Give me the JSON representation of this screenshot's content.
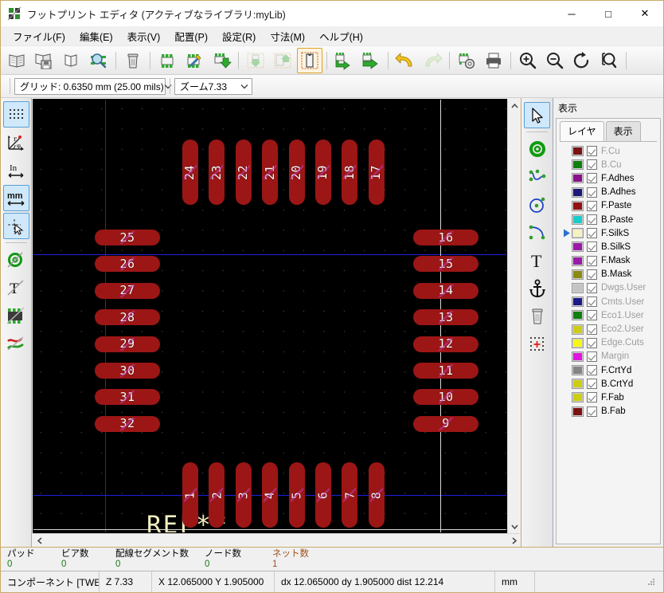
{
  "window": {
    "title": "フットプリント エディタ (アクティブなライブラリ:myLib)",
    "icon": "kicad-footprint-editor-icon",
    "minimize_label": "─",
    "maximize_label": "□",
    "close_label": "✕"
  },
  "menubar": {
    "items": [
      {
        "label": "ファイル(F)",
        "name": "menu-file"
      },
      {
        "label": "編集(E)",
        "name": "menu-edit"
      },
      {
        "label": "表示(V)",
        "name": "menu-view"
      },
      {
        "label": "配置(P)",
        "name": "menu-place"
      },
      {
        "label": "設定(R)",
        "name": "menu-preferences"
      },
      {
        "label": "寸法(M)",
        "name": "menu-dimensions"
      },
      {
        "label": "ヘルプ(H)",
        "name": "menu-help"
      }
    ]
  },
  "toolbar_top": {
    "buttons": [
      {
        "name": "select-active-library-button",
        "icon": "open-book-icon",
        "state": "normal"
      },
      {
        "name": "save-library-button",
        "icon": "book-save-icon",
        "state": "normal"
      },
      {
        "name": "new-footprint-button",
        "icon": "book-new-icon",
        "state": "normal"
      },
      {
        "name": "open-footprint-button",
        "icon": "footprint-search-icon",
        "state": "normal"
      },
      {
        "name": "separator-1",
        "icon": "separator",
        "state": "sep"
      },
      {
        "name": "delete-footprint-button",
        "icon": "trash-icon",
        "state": "normal"
      },
      {
        "name": "separator-2",
        "icon": "separator",
        "state": "sep"
      },
      {
        "name": "import-footprint-button",
        "icon": "footprint-chip-icon",
        "state": "normal"
      },
      {
        "name": "footprint-properties-button",
        "icon": "footprint-edit-icon",
        "state": "normal"
      },
      {
        "name": "export-footprint-button",
        "icon": "footprint-down-icon",
        "state": "normal"
      },
      {
        "name": "separator-3",
        "icon": "separator",
        "state": "sep"
      },
      {
        "name": "import-from-board-button",
        "icon": "board-import-icon",
        "state": "disabled"
      },
      {
        "name": "update-to-board-button",
        "icon": "board-update-icon",
        "state": "disabled"
      },
      {
        "name": "footprint-mode-button",
        "icon": "module-outline-icon",
        "state": "selected"
      },
      {
        "name": "separator-4",
        "icon": "separator",
        "state": "sep"
      },
      {
        "name": "import-module-button",
        "icon": "footprint-arrow-right-icon",
        "state": "normal"
      },
      {
        "name": "export-module-button",
        "icon": "footprint-arrow-out-icon",
        "state": "normal"
      },
      {
        "name": "separator-5",
        "icon": "separator",
        "state": "sep"
      },
      {
        "name": "undo-button",
        "icon": "undo-arrow-icon",
        "state": "normal"
      },
      {
        "name": "redo-button",
        "icon": "redo-arrow-icon",
        "state": "disabled"
      },
      {
        "name": "separator-6",
        "icon": "separator",
        "state": "sep"
      },
      {
        "name": "module-properties-button",
        "icon": "footprint-gear-icon",
        "state": "normal"
      },
      {
        "name": "print-button",
        "icon": "printer-icon",
        "state": "normal"
      },
      {
        "name": "separator-7",
        "icon": "separator",
        "state": "sep"
      },
      {
        "name": "zoom-in-button",
        "icon": "zoom-in-icon",
        "state": "normal"
      },
      {
        "name": "zoom-out-button",
        "icon": "zoom-out-icon",
        "state": "normal"
      },
      {
        "name": "zoom-redraw-button",
        "icon": "refresh-icon",
        "state": "normal"
      },
      {
        "name": "zoom-to-selection-button",
        "icon": "zoom-area-icon",
        "state": "normal"
      },
      {
        "name": "separator-8",
        "icon": "separator",
        "state": "sep"
      }
    ]
  },
  "toolbar_aux": {
    "grid": {
      "label": "グリッド:",
      "value": "グリッド: 0.6350 mm (25.00 mils)"
    },
    "zoom": {
      "value": "ズーム7.33"
    }
  },
  "toolbar_left": {
    "buttons": [
      {
        "name": "toggle-grid-button",
        "icon": "grid-dots-icon",
        "state": "active"
      },
      {
        "name": "polar-coords-button",
        "icon": "polar-coord-icon",
        "state": "normal"
      },
      {
        "name": "units-inch-button",
        "icon": "inch-units-icon",
        "state": "normal"
      },
      {
        "name": "units-mm-button",
        "icon": "mm-units-icon",
        "state": "active"
      },
      {
        "name": "cursor-shape-button",
        "icon": "full-crosshair-cursor-icon",
        "state": "active"
      },
      {
        "name": "separator-left-1",
        "icon": "separator",
        "state": "sep"
      },
      {
        "name": "show-pads-sketch-button",
        "icon": "pad-sketch-icon",
        "state": "normal"
      },
      {
        "name": "show-text-sketch-button",
        "icon": "text-sketch-icon",
        "state": "normal"
      },
      {
        "name": "show-graphics-sketch-button",
        "icon": "module-sketch-icon",
        "state": "normal"
      },
      {
        "name": "high-contrast-button",
        "icon": "contrast-edges-icon",
        "state": "normal"
      }
    ]
  },
  "toolbar_right": {
    "buttons": [
      {
        "name": "select-tool-button",
        "icon": "cursor-arrow-icon",
        "state": "active"
      },
      {
        "name": "separator-right-1",
        "icon": "separator",
        "state": "sep"
      },
      {
        "name": "add-pad-button",
        "icon": "pad-circle-icon",
        "state": "normal"
      },
      {
        "name": "add-line-button",
        "icon": "polyline-icon",
        "state": "normal"
      },
      {
        "name": "add-circle-button",
        "icon": "circle-icon",
        "state": "normal"
      },
      {
        "name": "add-arc-button",
        "icon": "arc-icon",
        "state": "normal"
      },
      {
        "name": "add-text-button",
        "icon": "text-T-icon",
        "state": "normal"
      },
      {
        "name": "set-anchor-button",
        "icon": "anchor-icon",
        "state": "normal"
      },
      {
        "name": "delete-item-button",
        "icon": "trash-can-icon",
        "state": "normal"
      },
      {
        "name": "set-origin-button",
        "icon": "grid-origin-icon",
        "state": "normal"
      }
    ]
  },
  "layers_panel": {
    "title": "表示",
    "tabs": [
      {
        "label": "レイヤ",
        "name": "tab-layers",
        "active": true
      },
      {
        "label": "表示",
        "name": "tab-render",
        "active": false
      }
    ],
    "selected_layer": "F.SilkS",
    "layers": [
      {
        "name": "F.Cu",
        "color": "#7a1212",
        "visible": true,
        "dim": true
      },
      {
        "name": "B.Cu",
        "color": "#0e8010",
        "visible": true,
        "dim": true
      },
      {
        "name": "F.Adhes",
        "color": "#8a0f8a",
        "visible": true,
        "dim": false
      },
      {
        "name": "B.Adhes",
        "color": "#1a1a7a",
        "visible": true,
        "dim": false
      },
      {
        "name": "F.Paste",
        "color": "#931111",
        "visible": true,
        "dim": false
      },
      {
        "name": "B.Paste",
        "color": "#19cccc",
        "visible": true,
        "dim": false
      },
      {
        "name": "F.SilkS",
        "color": "#f5f2c2",
        "visible": true,
        "dim": false
      },
      {
        "name": "B.SilkS",
        "color": "#9b1aa8",
        "visible": true,
        "dim": false
      },
      {
        "name": "F.Mask",
        "color": "#9b1aa8",
        "visible": true,
        "dim": false
      },
      {
        "name": "B.Mask",
        "color": "#8a8a12",
        "visible": true,
        "dim": false
      },
      {
        "name": "Dwgs.User",
        "color": "#c4c4c4",
        "visible": true,
        "dim": true
      },
      {
        "name": "Cmts.User",
        "color": "#1a1a8a",
        "visible": true,
        "dim": true
      },
      {
        "name": "Eco1.User",
        "color": "#0e8010",
        "visible": true,
        "dim": true
      },
      {
        "name": "Eco2.User",
        "color": "#cdcd14",
        "visible": true,
        "dim": true
      },
      {
        "name": "Edge.Cuts",
        "color": "#f7f718",
        "visible": true,
        "dim": true
      },
      {
        "name": "Margin",
        "color": "#e014e0",
        "visible": true,
        "dim": true
      },
      {
        "name": "F.CrtYd",
        "color": "#848484",
        "visible": true,
        "dim": false
      },
      {
        "name": "B.CrtYd",
        "color": "#cdcd14",
        "visible": true,
        "dim": false
      },
      {
        "name": "F.Fab",
        "color": "#cdcd14",
        "visible": true,
        "dim": false
      },
      {
        "name": "B.Fab",
        "color": "#7a1212",
        "visible": true,
        "dim": false
      }
    ]
  },
  "canvas": {
    "refdes": "REF**",
    "pad_color": "#9c1616",
    "background": "#000000",
    "pads_top": [
      "24",
      "23",
      "22",
      "21",
      "20",
      "19",
      "18",
      "17"
    ],
    "pads_bottom": [
      "1",
      "2",
      "3",
      "4",
      "5",
      "6",
      "7",
      "8"
    ],
    "pads_left": [
      "25",
      "26",
      "27",
      "28",
      "29",
      "30",
      "31",
      "32"
    ],
    "pads_right": [
      "16",
      "15",
      "14",
      "13",
      "12",
      "11",
      "10",
      "9"
    ]
  },
  "stats_bar": {
    "items": [
      {
        "label": "パッド",
        "value": "0",
        "name": "stat-pads"
      },
      {
        "label": "ビア数",
        "value": "0",
        "name": "stat-vias"
      },
      {
        "label": "配線セグメント数",
        "value": "0",
        "name": "stat-track-segments"
      },
      {
        "label": "ノード数",
        "value": "0",
        "name": "stat-nodes"
      },
      {
        "label": "ネット数",
        "value": "1",
        "name": "stat-nets"
      }
    ]
  },
  "status_bar": {
    "component": "コンポーネント [TWE...",
    "zoom": "Z 7.33",
    "coords": "X 12.065000  Y 1.905000",
    "delta": "dx 12.065000  dy 1.905000  dist 12.214",
    "units": "mm",
    "extra": ""
  }
}
